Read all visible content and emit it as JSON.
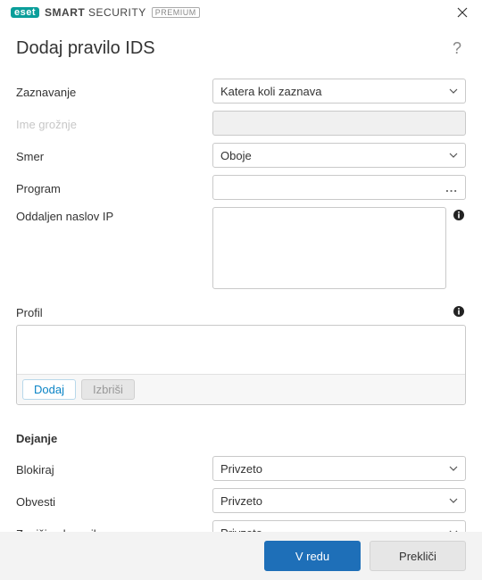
{
  "brand": {
    "eset": "eset",
    "product_bold": "SMART",
    "product_rest": "SECURITY",
    "badge": "PREMIUM"
  },
  "dialog": {
    "title": "Dodaj pravilo IDS"
  },
  "form": {
    "detection_label": "Zaznavanje",
    "detection_value": "Katera koli zaznava",
    "threat_label": "Ime grožnje",
    "direction_label": "Smer",
    "direction_value": "Oboje",
    "program_label": "Program",
    "program_value": "",
    "remote_ip_label": "Oddaljen naslov IP",
    "remote_ip_value": "",
    "profile_label": "Profil",
    "add_btn": "Dodaj",
    "delete_btn": "Izbriši"
  },
  "action_section": {
    "heading": "Dejanje",
    "block_label": "Blokiraj",
    "block_value": "Privzeto",
    "notify_label": "Obvesti",
    "notify_value": "Privzeto",
    "log_label": "Zapiši v dnevnik",
    "log_value": "Privzeto"
  },
  "footer": {
    "ok": "V redu",
    "cancel": "Prekliči"
  }
}
